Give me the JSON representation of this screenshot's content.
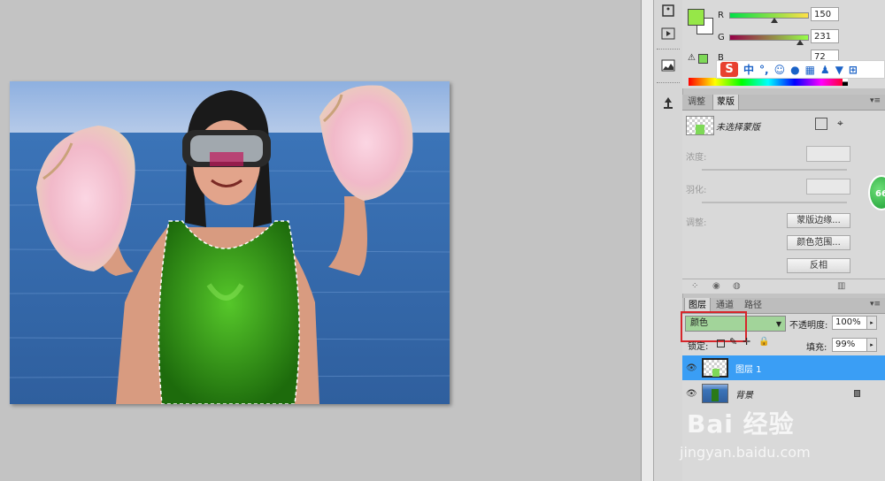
{
  "color_panel": {
    "channels": [
      {
        "label": "R",
        "value": "150"
      },
      {
        "label": "G",
        "value": "231"
      },
      {
        "label": "B",
        "value": "72"
      }
    ],
    "foreground_color": "#96e748",
    "background_color": "#ffffff"
  },
  "ime_toolbar": {
    "logo": "S",
    "lang": "中"
  },
  "mask_panel": {
    "tabs": [
      "调整",
      "蒙版"
    ],
    "title": "未选择蒙版",
    "density_label": "浓度:",
    "feather_label": "羽化:",
    "adjust_label": "调整:",
    "edge_button": "蒙版边缘...",
    "color_range_button": "颜色范围...",
    "invert_button": "反相"
  },
  "layers_panel": {
    "tabs": [
      "图层",
      "通道",
      "路径"
    ],
    "blend_mode": "颜色",
    "opacity_label": "不透明度:",
    "opacity_value": "100%",
    "lock_label": "锁定:",
    "fill_label": "填充:",
    "fill_value": "99%",
    "layers": [
      {
        "name": "图层 1",
        "selected": true
      },
      {
        "name": "背景",
        "selected": false
      }
    ]
  },
  "watermark": {
    "brand": "Bai 经验",
    "url": "jingyan.baidu.com"
  },
  "badge": {
    "text": "66"
  },
  "accent_selected": "#3a9ef5",
  "highlight_red": "#d7262b"
}
